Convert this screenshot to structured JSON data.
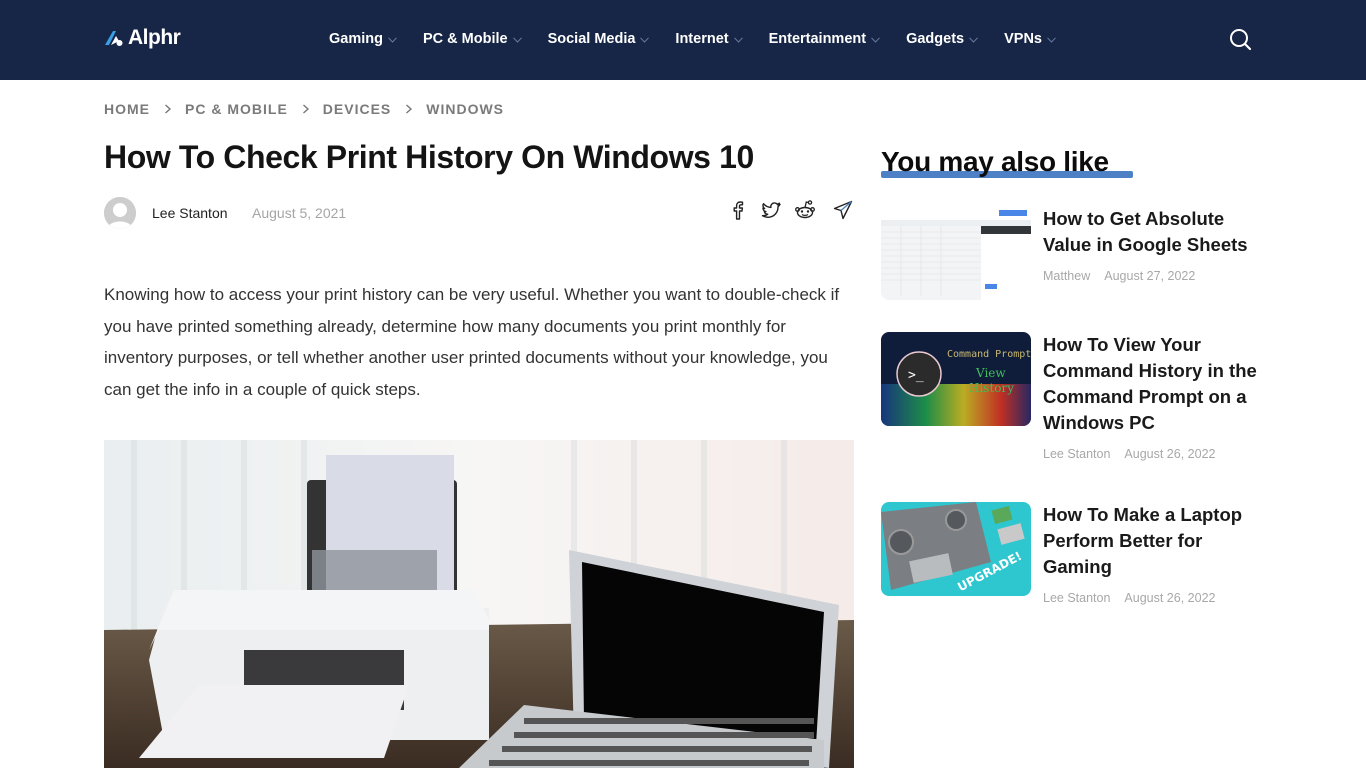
{
  "site": {
    "logo_text": "Alphr",
    "brand_color": "#172646",
    "accent_color": "#4e80c5"
  },
  "nav": {
    "items": [
      {
        "label": "Gaming"
      },
      {
        "label": "PC & Mobile"
      },
      {
        "label": "Social Media"
      },
      {
        "label": "Internet"
      },
      {
        "label": "Entertainment"
      },
      {
        "label": "Gadgets"
      },
      {
        "label": "VPNs"
      }
    ],
    "search_icon": "search-icon"
  },
  "breadcrumb": [
    "HOME",
    "PC & MOBILE",
    "DEVICES",
    "WINDOWS"
  ],
  "article": {
    "title": "How To Check Print History On Windows 10",
    "author": "Lee Stanton",
    "date": "August 5, 2021",
    "share_icons": [
      "facebook-icon",
      "twitter-icon",
      "reddit-icon",
      "telegram-icon"
    ],
    "lead": "Knowing how to access your print history can be very useful. Whether you want to double-check if you have printed something already, determine how many documents you print monthly for inventory purposes, or tell whether another user printed documents without your knowledge, you can get the info in a couple of quick steps.",
    "hero_image_alt": "Printer and laptop on a wooden desk"
  },
  "sidebar": {
    "title": "You may also like",
    "cards": [
      {
        "title": "How to Get Absolute Value in Google Sheets",
        "author": "Matthew",
        "date": "August 27, 2022"
      },
      {
        "title": "How To View Your Command History in the Command Prompt on a Windows PC",
        "author": "Lee Stanton",
        "date": "August 26, 2022"
      },
      {
        "title": "How To Make a Laptop Perform Better for Gaming",
        "author": "Lee Stanton",
        "date": "August 26, 2022"
      }
    ]
  }
}
